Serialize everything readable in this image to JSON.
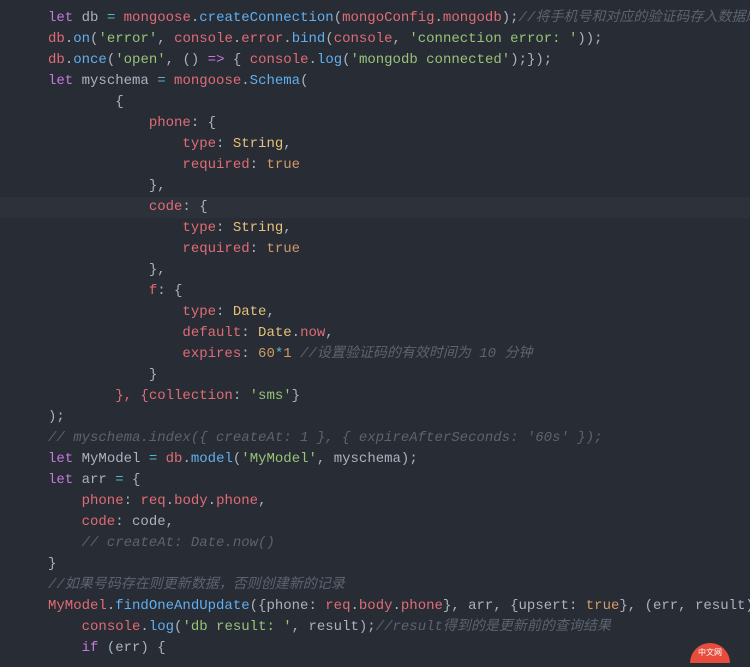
{
  "code": {
    "l1": {
      "a": "let",
      "b": " db ",
      "c": "=",
      "d": "mongoose",
      "e": ".",
      "f": "createConnection",
      "g": "(",
      "h": "mongoConfig",
      "i": ".",
      "j": "mongodb",
      "k": ");",
      "cm": "//将手机号和对应的验证码存入数据库"
    },
    "l2": {
      "a": "db",
      "b": ".",
      "c": "on",
      "d": "(",
      "e": "'error'",
      "f": ", ",
      "g": "console",
      "h": ".",
      "i": "error",
      "j": ".",
      "k": "bind",
      "l": "(",
      "m": "console",
      "n": ", ",
      "o": "'connection error: '",
      "p": "));"
    },
    "l3": {
      "a": "db",
      "b": ".",
      "c": "once",
      "d": "(",
      "e": "'open'",
      "f": ", () ",
      "g": "=>",
      "h": " { ",
      "i": "console",
      "j": ".",
      "k": "log",
      "l": "(",
      "m": "'mongodb connected'",
      "n": ");});"
    },
    "l4": {
      "a": "let",
      "b": " myschema ",
      "c": "=",
      "d": "mongoose",
      "e": ".",
      "f": "Schema",
      "g": "("
    },
    "l5": "        {",
    "l6": {
      "a": "            phone",
      "b": ": {"
    },
    "l7": {
      "a": "                type",
      "b": ": ",
      "c": "String",
      "d": ","
    },
    "l8": {
      "a": "                required",
      "b": ": ",
      "c": "true"
    },
    "l9": "            },",
    "l10": {
      "a": "            code",
      "b": ": {"
    },
    "l11": {
      "a": "                type",
      "b": ": ",
      "c": "String",
      "d": ","
    },
    "l12": {
      "a": "                required",
      "b": ": ",
      "c": "true"
    },
    "l13": "            },",
    "l14": {
      "a": "            f",
      "b": ": {"
    },
    "l15": {
      "a": "                type",
      "b": ": ",
      "c": "Date",
      "d": ","
    },
    "l16": {
      "a": "                default",
      "b": ": ",
      "c": "Date",
      "d": ".",
      "e": "now",
      "f": ","
    },
    "l17": {
      "a": "                expires",
      "b": ": ",
      "c": "60",
      "d": "*",
      "e": "1",
      "f": " //设置验证码的有效时间为 10 分钟"
    },
    "l18": "            }",
    "l19": {
      "a": "        }, {collection",
      "b": ": ",
      "c": "'sms'",
      "d": "}"
    },
    "l20": ");",
    "l21": "// myschema.index({ createAt: 1 }, { expireAfterSeconds: '60s' });",
    "l22": {
      "a": "let",
      "b": " MyModel ",
      "c": "=",
      "d": "db",
      "e": ".",
      "f": "model",
      "g": "(",
      "h": "'MyModel'",
      "i": ", myschema);"
    },
    "l23": {
      "a": "let",
      "b": " arr ",
      "c": "=",
      "d": " {"
    },
    "l24": {
      "a": "    phone",
      "b": ": ",
      "c": "req",
      "d": ".",
      "e": "body",
      "f": ".",
      "g": "phone",
      "h": ","
    },
    "l25": {
      "a": "    code",
      "b": ": code,"
    },
    "l26": "    // createAt: Date.now()",
    "l27": "}",
    "l28": "//如果号码存在则更新数据，否则创建新的记录",
    "l29": {
      "a": "MyModel",
      "b": ".",
      "c": "findOneAndUpdate",
      "d": "({phone",
      "e": ": ",
      "f": "req",
      "g": ".",
      "h": "body",
      "i": ".",
      "j": "phone",
      "k": "}, arr, {upsert",
      "l": ": ",
      "m": "true",
      "n": "}, (err, result) ",
      "o": "=>",
      "p": " {"
    },
    "l30": {
      "a": "console",
      "b": ".",
      "c": "log",
      "d": "(",
      "e": "'db result: '",
      "f": ", result);",
      "cm": "//result得到的是更新前的查询结果"
    },
    "l31": {
      "a": "    ",
      "b": "if",
      "c": " (err) {"
    }
  },
  "badge": "中文网"
}
